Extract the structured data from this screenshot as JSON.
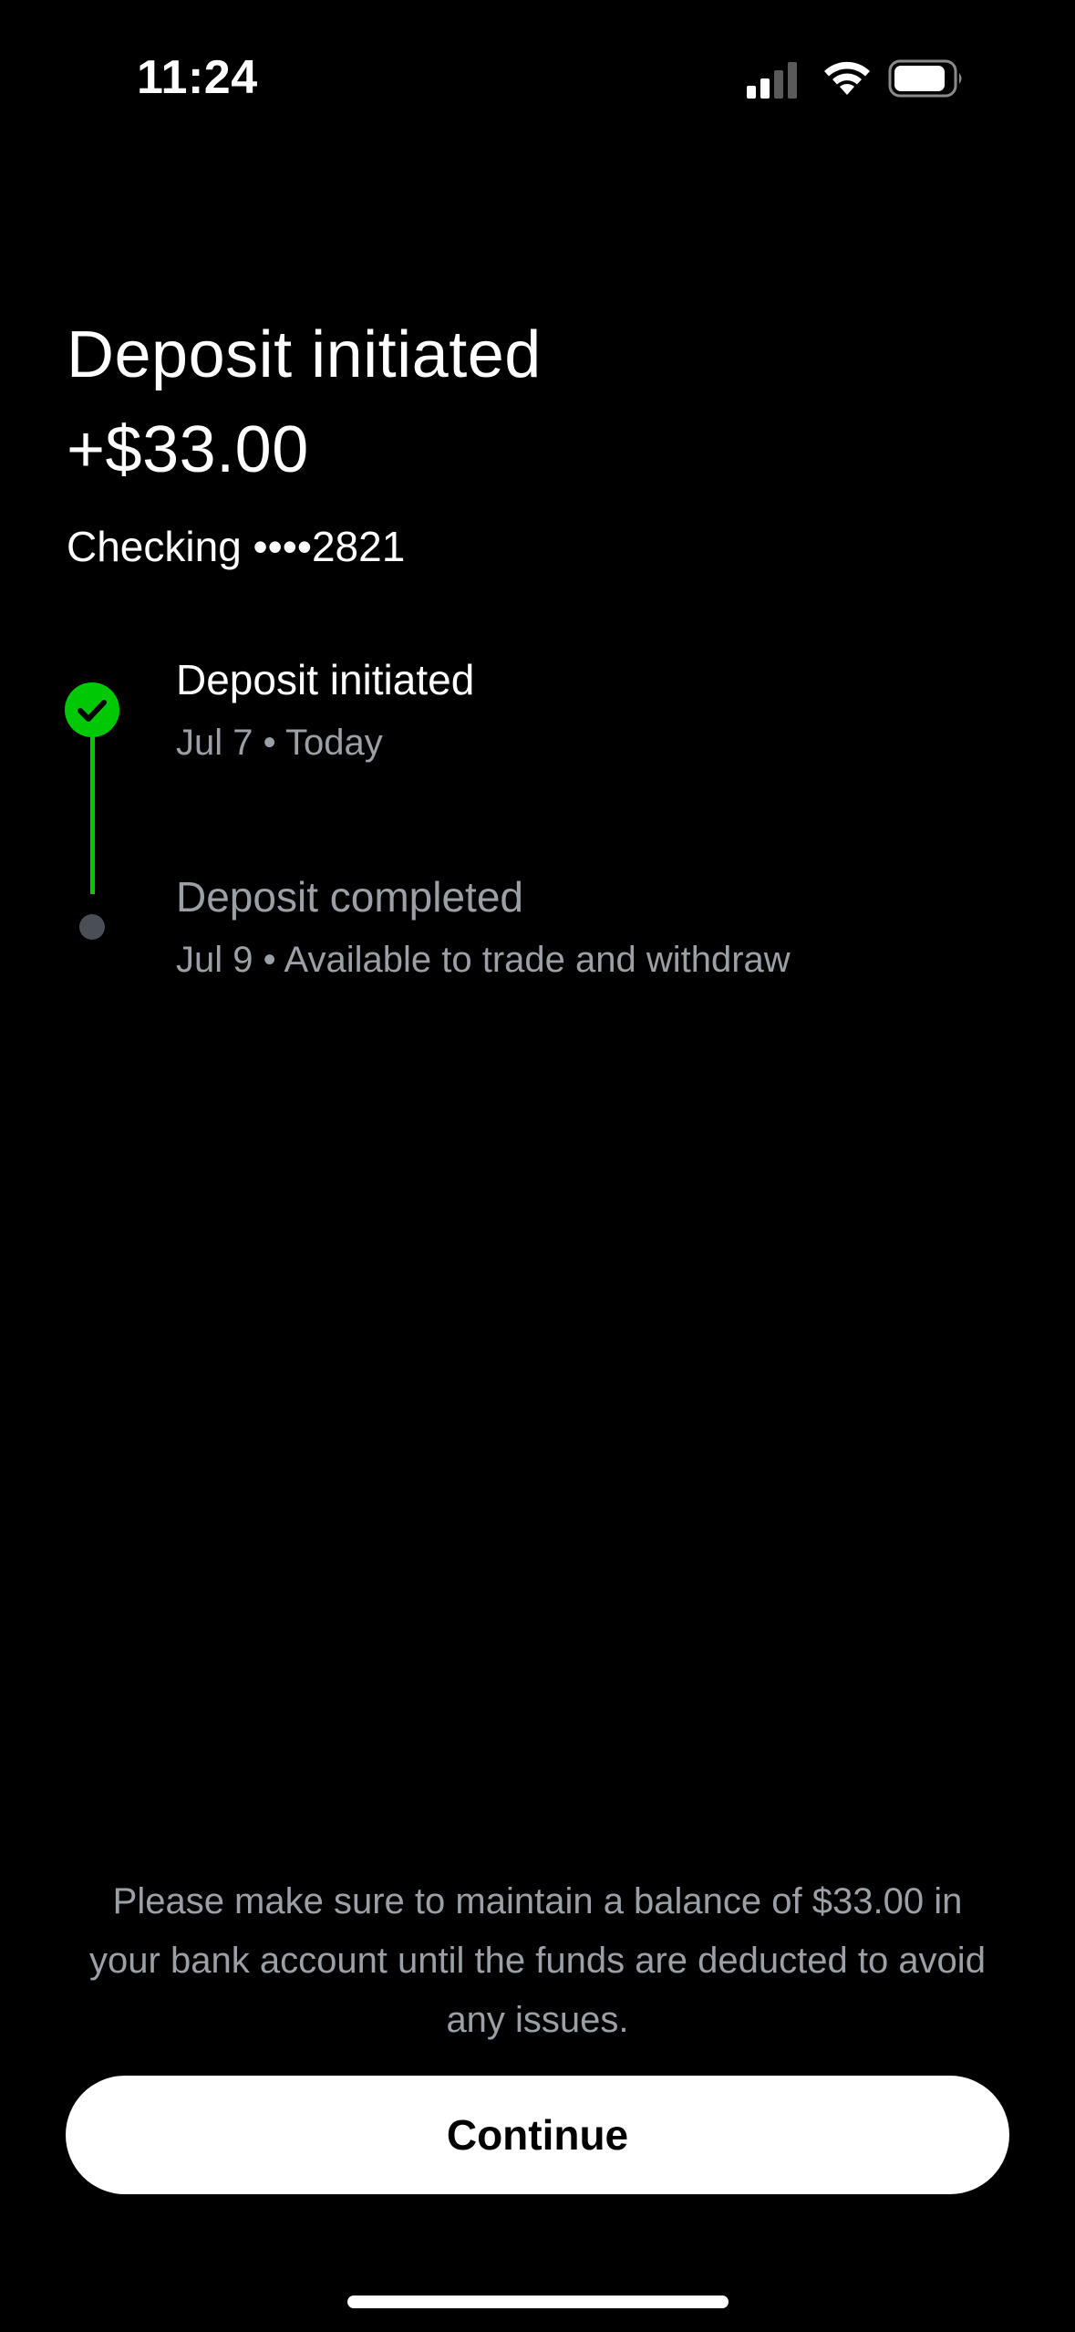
{
  "status_bar": {
    "time": "11:24",
    "signal_icon": "cellular-signal-icon",
    "wifi_icon": "wifi-icon",
    "battery_icon": "battery-icon"
  },
  "header": {
    "title": "Deposit initiated",
    "amount": "+$33.00",
    "account": "Checking ••••2821"
  },
  "timeline": {
    "steps": [
      {
        "title": "Deposit initiated",
        "subtitle": "Jul 7 • Today",
        "status": "complete",
        "icon": "check-circle-icon"
      },
      {
        "title": "Deposit completed",
        "subtitle": "Jul 9 • Available to trade and withdraw",
        "status": "pending",
        "icon": "dot-icon"
      }
    ]
  },
  "disclaimer": "Please make sure to maintain a balance of $33.00 in your bank account until the funds are deducted to avoid any issues.",
  "actions": {
    "continue_label": "Continue"
  },
  "colors": {
    "background": "#000000",
    "accent_green": "#00c805",
    "muted_text": "#9aa0a6",
    "pending_dot": "#4a4f56",
    "button_bg": "#ffffff"
  }
}
